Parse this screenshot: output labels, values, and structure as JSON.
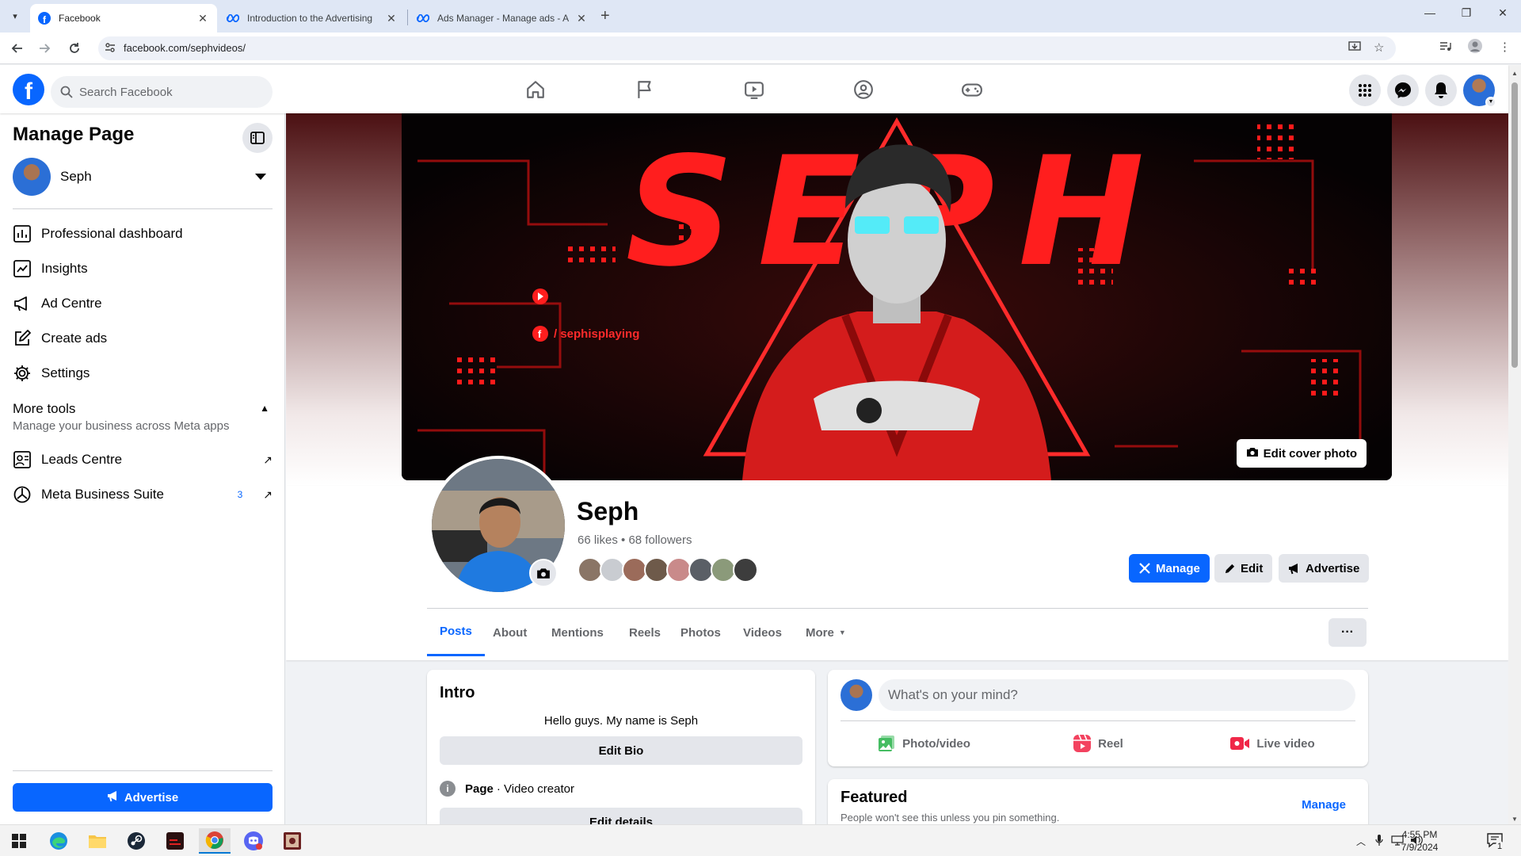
{
  "browser": {
    "tabs": [
      {
        "title": "Facebook",
        "active": true
      },
      {
        "title": "Introduction to the Advertising",
        "active": false
      },
      {
        "title": "Ads Manager - Manage ads - A",
        "active": false
      }
    ],
    "url": "facebook.com/sephvideos/"
  },
  "fb": {
    "search_placeholder": "Search Facebook",
    "brand_color": "#0866ff"
  },
  "sidebar": {
    "title": "Manage Page",
    "page_name": "Seph",
    "items": [
      {
        "label": "Professional dashboard",
        "icon": "dashboard-icon"
      },
      {
        "label": "Insights",
        "icon": "insights-icon"
      },
      {
        "label": "Ad Centre",
        "icon": "megaphone-icon"
      },
      {
        "label": "Create ads",
        "icon": "pencil-square-icon"
      },
      {
        "label": "Settings",
        "icon": "gear-icon"
      }
    ],
    "more_tools": {
      "title": "More tools",
      "subtitle": "Manage your business across Meta apps",
      "items": [
        {
          "label": "Leads Centre",
          "icon": "leads-icon",
          "badge": ""
        },
        {
          "label": "Meta Business Suite",
          "icon": "business-suite-icon",
          "badge": "3"
        }
      ]
    },
    "advertise_label": "Advertise"
  },
  "profile": {
    "cover_text": "SEPH",
    "cover_handle": "/ sephisplaying",
    "edit_cover_label": "Edit cover photo",
    "name": "Seph",
    "stats": "66 likes • 68 followers",
    "buttons": {
      "manage": "Manage",
      "edit": "Edit",
      "advertise": "Advertise"
    },
    "tabs": [
      "Posts",
      "About",
      "Mentions",
      "Reels",
      "Photos",
      "Videos",
      "More"
    ],
    "friend_colors": [
      "#8a7566",
      "#c9ccd1",
      "#9b6b5a",
      "#6e5a4a",
      "#c98a8a",
      "#5a5f66",
      "#8b9a7a",
      "#3d3d3d"
    ]
  },
  "intro": {
    "title": "Intro",
    "bio": "Hello guys. My name is Seph",
    "edit_bio": "Edit Bio",
    "info_label": "Page",
    "info_value": "· Video creator",
    "edit_details": "Edit details"
  },
  "composer": {
    "placeholder": "What's on your mind?",
    "actions": [
      {
        "label": "Photo/video",
        "icon": "photo-icon",
        "color": "#45bd62"
      },
      {
        "label": "Reel",
        "icon": "reel-icon",
        "color": "#f3425f"
      },
      {
        "label": "Live video",
        "icon": "live-video-icon",
        "color": "#f02849"
      }
    ]
  },
  "featured": {
    "title": "Featured",
    "subtitle": "People won't see this unless you pin something.",
    "manage": "Manage"
  },
  "taskbar": {
    "time": "4:55 PM",
    "date": "7/9/2024",
    "notifications": "1"
  }
}
